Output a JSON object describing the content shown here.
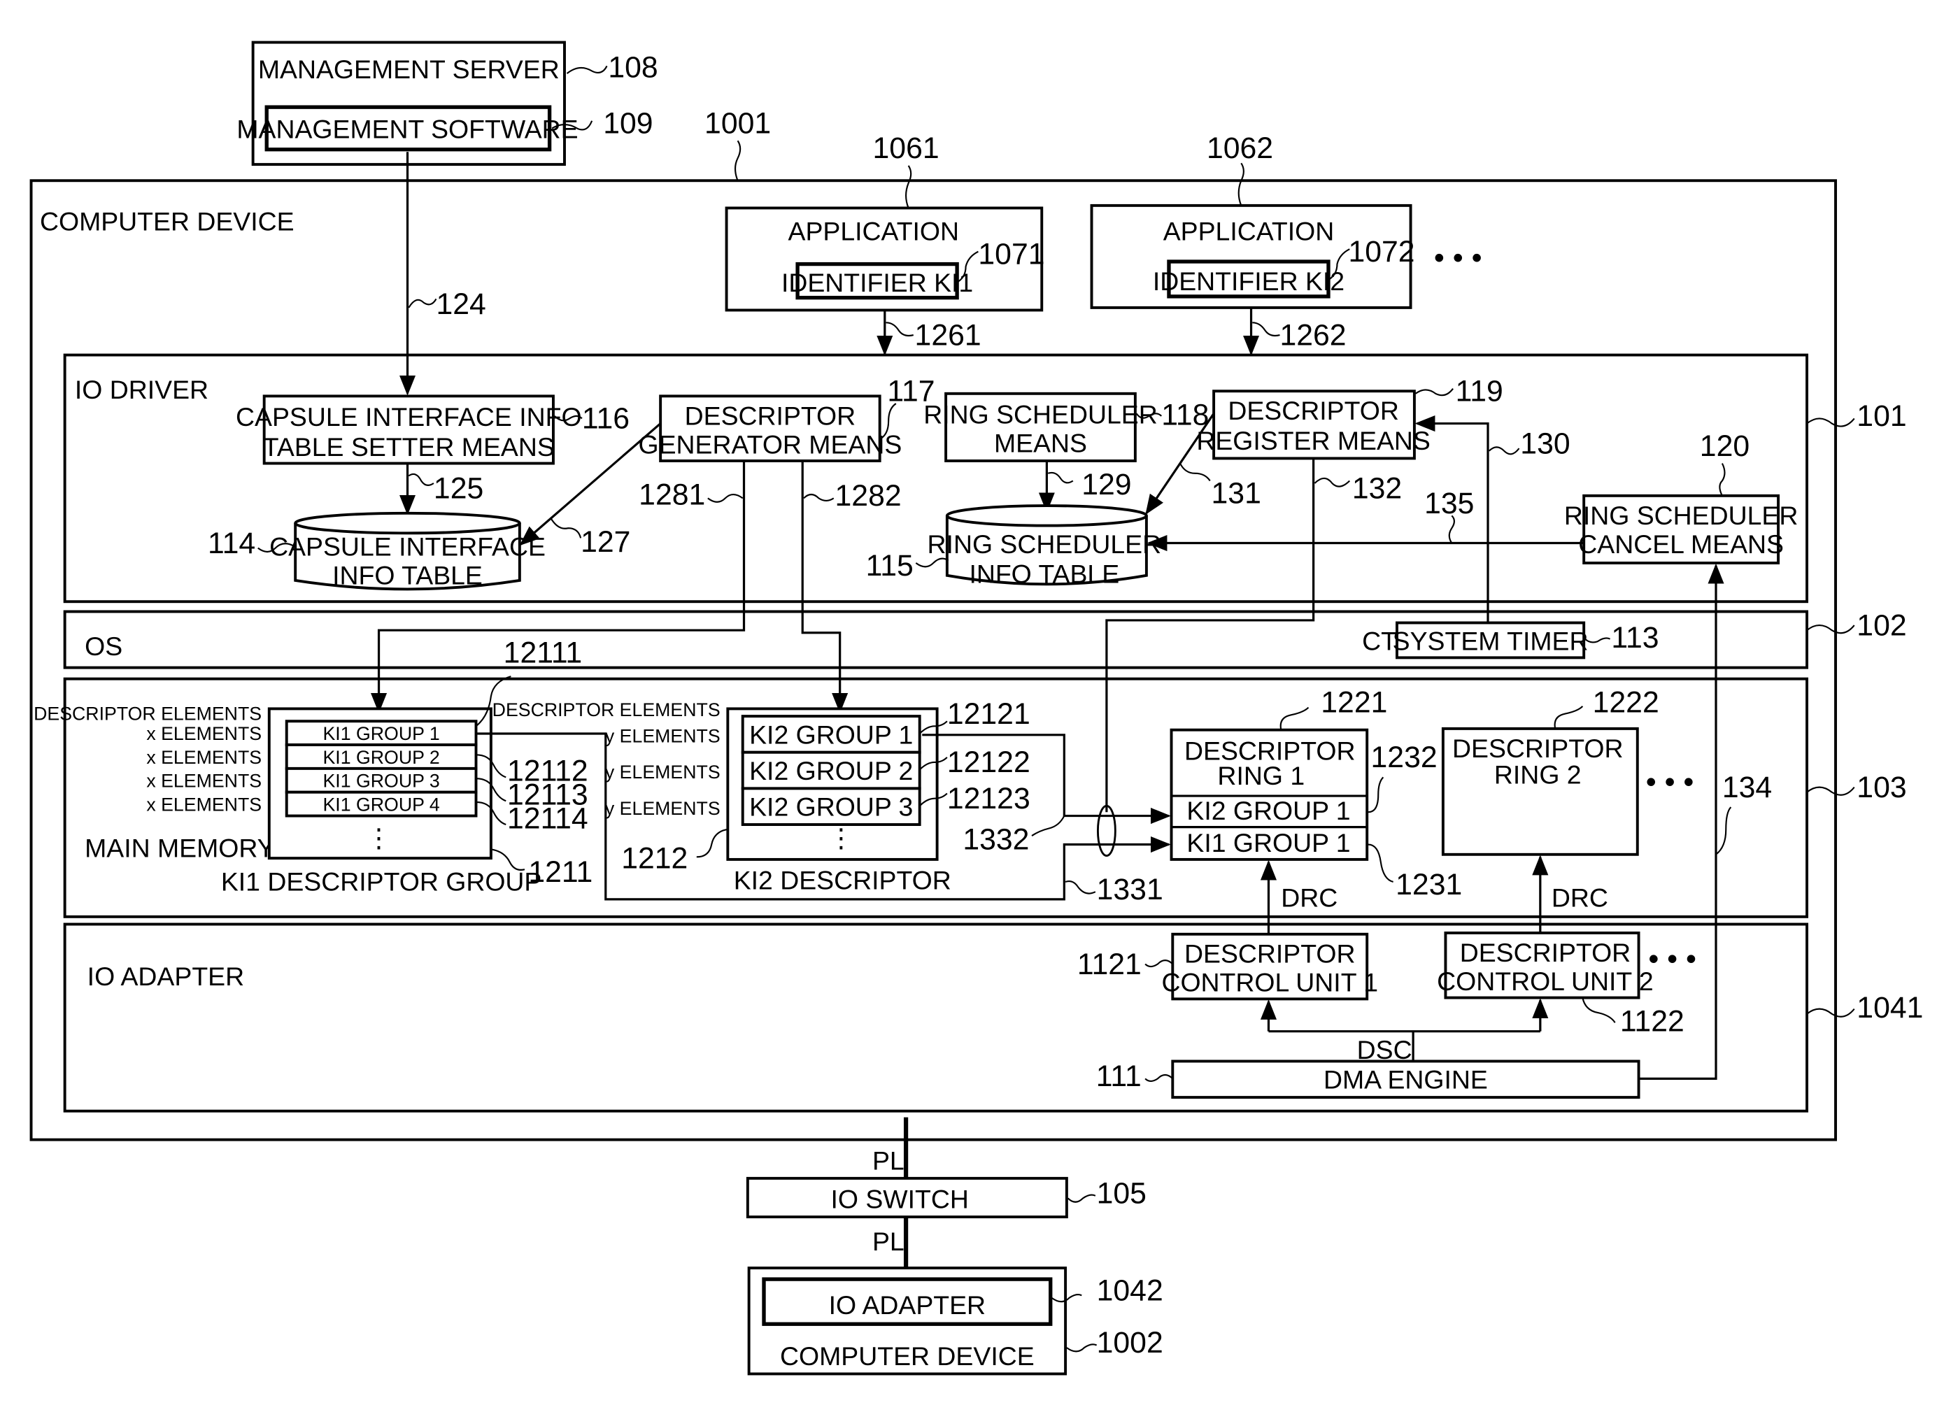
{
  "figure": {
    "management_server": {
      "label": "MANAGEMENT SERVER",
      "ref": "108"
    },
    "management_software": {
      "label": "MANAGEMENT SOFTWARE",
      "ref": "109"
    },
    "computer_device_1": {
      "label": "COMPUTER DEVICE",
      "ref": "1001"
    },
    "application_1": {
      "label": "APPLICATION",
      "ref": "1061",
      "identifier": "IDENTIFIER KI1",
      "identifier_ref": "1071",
      "arrow_ref": "1261"
    },
    "application_2": {
      "label": "APPLICATION",
      "ref": "1062",
      "identifier": "IDENTIFIER KI2",
      "identifier_ref": "1072",
      "arrow_ref": "1262"
    },
    "ellipsis": "• • •",
    "io_driver": {
      "label": "IO DRIVER",
      "ref": "101",
      "capsule_setter": {
        "line1": "CAPSULE INTERFACE INFO",
        "line2": "TABLE SETTER MEANS",
        "ref": "116"
      },
      "capsule_table": {
        "line1": "CAPSULE INTERFACE",
        "line2": "INFO TABLE",
        "ref": "114"
      },
      "descriptor_generator": {
        "line1": "DESCRIPTOR",
        "line2": "GENERATOR MEANS",
        "ref": "117"
      },
      "ring_scheduler": {
        "line1": "RING SCHEDULER",
        "line2": "MEANS",
        "ref": "118"
      },
      "ring_scheduler_table": {
        "line1": "RING SCHEDULER",
        "line2": "INFO TABLE",
        "ref": "115"
      },
      "descriptor_register": {
        "line1": "DESCRIPTOR",
        "line2": "REGISTER MEANS",
        "ref": "119"
      },
      "ring_scheduler_cancel": {
        "line1": "RING SCHEDULER",
        "line2": "CANCEL MEANS",
        "ref": "120"
      },
      "signal_refs": {
        "s124": "124",
        "s125": "125",
        "s127": "127",
        "s1281": "1281",
        "s1282": "1282",
        "s129": "129",
        "s130": "130",
        "s131": "131",
        "s132": "132",
        "s135": "135"
      }
    },
    "os": {
      "label": "OS",
      "ref": "102",
      "ct_label": "CT",
      "system_timer": "SYSTEM TIMER",
      "system_timer_ref": "113"
    },
    "main_memory": {
      "label": "MAIN MEMORY",
      "ref": "103",
      "ki1_group": {
        "title": "KI1 DESCRIPTOR GROUP",
        "ref": "1211",
        "header": "DESCRIPTOR ELEMENTS",
        "rows": [
          {
            "elements": "x ELEMENTS",
            "label": "KI1 GROUP 1",
            "ref": "12111"
          },
          {
            "elements": "x ELEMENTS",
            "label": "KI1 GROUP 2",
            "ref": "12112"
          },
          {
            "elements": "x ELEMENTS",
            "label": "KI1 GROUP 3",
            "ref": "12113"
          },
          {
            "elements": "x ELEMENTS",
            "label": "KI1 GROUP 4",
            "ref": "12114"
          }
        ],
        "more": "⋮"
      },
      "ki2_group": {
        "title": "KI2 DESCRIPTOR",
        "ref": "1212",
        "header": "DESCRIPTOR ELEMENTS",
        "rows": [
          {
            "elements": "y ELEMENTS",
            "label": "KI2 GROUP 1",
            "ref": "12121"
          },
          {
            "elements": "y ELEMENTS",
            "label": "KI2 GROUP 2",
            "ref": "12122"
          },
          {
            "elements": "y ELEMENTS",
            "label": "KI2 GROUP 3",
            "ref": "12123"
          }
        ],
        "more": "⋮"
      },
      "ring_1": {
        "line1": "DESCRIPTOR",
        "line2": "RING 1",
        "ref": "1221",
        "slot_top": "KI2 GROUP 1",
        "slot_top_ref": "1232",
        "slot_bottom": "KI1 GROUP 1",
        "slot_bottom_ref": "1231"
      },
      "ring_2": {
        "line1": "DESCRIPTOR",
        "line2": "RING 2",
        "ref": "1222"
      },
      "path_refs": {
        "p1331": "1331",
        "p1332": "1332",
        "p134": "134"
      }
    },
    "io_adapter": {
      "label": "IO ADAPTER",
      "ref": "1041",
      "control_unit_1": {
        "line1": "DESCRIPTOR",
        "line2": "CONTROL UNIT 1",
        "ref": "1121"
      },
      "control_unit_2": {
        "line1": "DESCRIPTOR",
        "line2": "CONTROL UNIT 2",
        "ref": "1122"
      },
      "dma_engine": {
        "label": "DMA ENGINE",
        "ref": "111"
      },
      "drc": "DRC",
      "dsc": "DSC"
    },
    "pl": "PL",
    "io_switch": {
      "label": "IO SWITCH",
      "ref": "105"
    },
    "computer_device_2": {
      "label": "COMPUTER DEVICE",
      "ref": "1002",
      "io_adapter": "IO ADAPTER",
      "io_adapter_ref": "1042"
    }
  }
}
